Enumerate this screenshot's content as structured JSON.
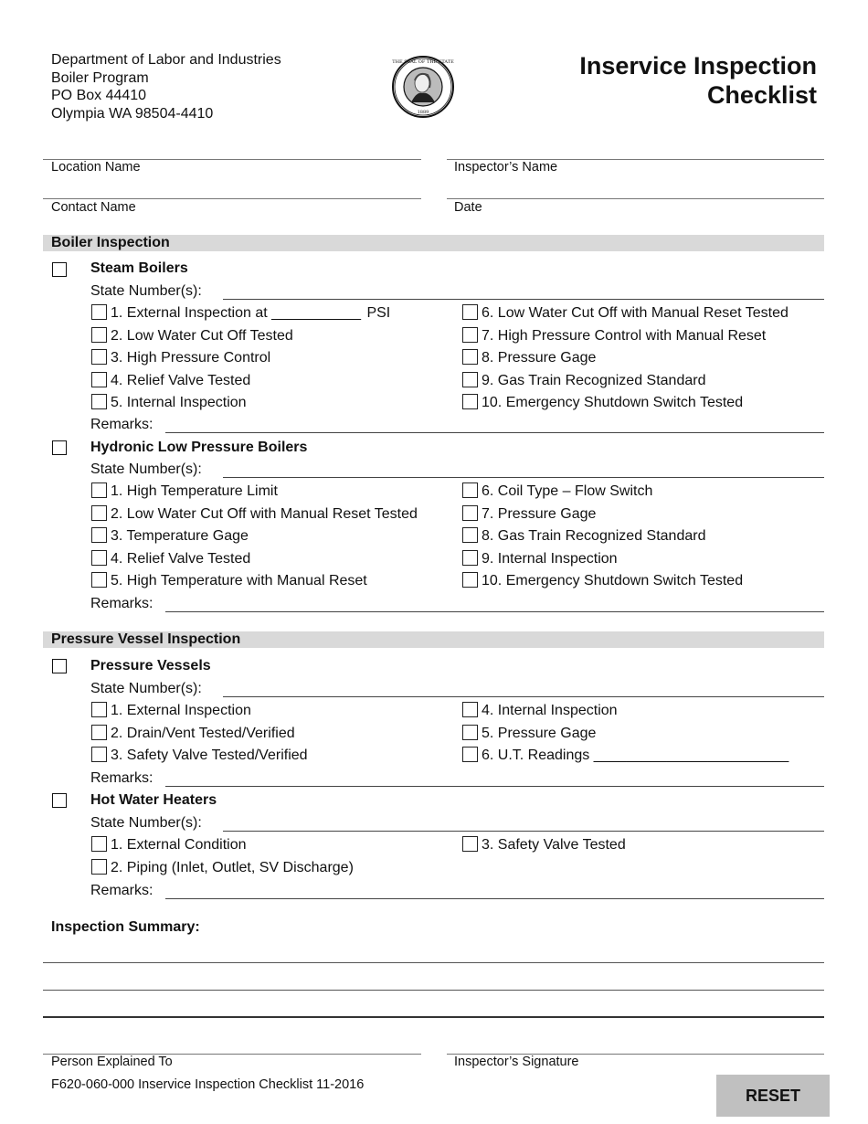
{
  "header": {
    "address_lines": [
      "Department of Labor and Industries",
      "Boiler Program",
      "PO Box 44410",
      "Olympia WA 98504-4410"
    ],
    "seal_icon": "washington-state-seal",
    "title_line1": "Inservice Inspection",
    "title_line2": "Checklist"
  },
  "info_fields": {
    "location_name": {
      "label": "Location Name",
      "value": ""
    },
    "inspectors_name": {
      "label": "Inspector’s Name",
      "value": ""
    },
    "contact_name": {
      "label": "Contact Name",
      "value": ""
    },
    "date": {
      "label": "Date",
      "value": ""
    }
  },
  "boiler_inspection": {
    "heading": "Boiler Inspection",
    "steam_boilers": {
      "title": "Steam Boilers",
      "state_numbers_label": "State Number(s):",
      "state_numbers_value": "",
      "left_items": [
        {
          "label_before": "1. External Inspection at",
          "blank": "___________",
          "label_after": "PSI",
          "checked": false
        },
        {
          "label": "2. Low Water Cut Off Tested",
          "checked": false
        },
        {
          "label": "3. High Pressure Control",
          "checked": false
        },
        {
          "label": "4. Relief Valve Tested",
          "checked": false
        },
        {
          "label": "5. Internal Inspection",
          "checked": false
        }
      ],
      "right_items": [
        {
          "label": "6. Low Water Cut Off with Manual Reset Tested",
          "checked": false
        },
        {
          "label": "7. High Pressure Control with Manual Reset",
          "checked": false
        },
        {
          "label": "8. Pressure Gage",
          "checked": false
        },
        {
          "label": "9. Gas Train Recognized Standard",
          "checked": false
        },
        {
          "label": "10. Emergency Shutdown Switch Tested",
          "checked": false
        }
      ],
      "remarks_label": "Remarks:",
      "remarks_value": ""
    },
    "hydronic_boilers": {
      "title": "Hydronic Low Pressure Boilers",
      "state_numbers_label": "State Number(s):",
      "state_numbers_value": "",
      "left_items": [
        {
          "label": "1. High Temperature Limit",
          "checked": false
        },
        {
          "label": "2. Low Water Cut Off with Manual Reset Tested",
          "checked": false
        },
        {
          "label": "3. Temperature Gage",
          "checked": false
        },
        {
          "label": "4. Relief Valve Tested",
          "checked": false
        },
        {
          "label": "5. High Temperature with Manual Reset",
          "checked": false
        }
      ],
      "right_items": [
        {
          "label": "6. Coil Type – Flow Switch",
          "checked": false
        },
        {
          "label": "7. Pressure Gage",
          "checked": false
        },
        {
          "label": "8. Gas Train Recognized Standard",
          "checked": false
        },
        {
          "label": "9. Internal Inspection",
          "checked": false
        },
        {
          "label": "10. Emergency Shutdown Switch Tested",
          "checked": false
        }
      ],
      "remarks_label": "Remarks:",
      "remarks_value": ""
    }
  },
  "pressure_vessel_inspection": {
    "heading": "Pressure Vessel Inspection",
    "pressure_vessels": {
      "title": "Pressure Vessels",
      "state_numbers_label": "State Number(s):",
      "state_numbers_value": "",
      "left_items": [
        {
          "label": "1. External Inspection",
          "checked": false
        },
        {
          "label": "2. Drain/Vent Tested/Verified",
          "checked": false
        },
        {
          "label": "3. Safety Valve Tested/Verified",
          "checked": false
        }
      ],
      "right_items": [
        {
          "label": "4. Internal Inspection",
          "checked": false
        },
        {
          "label": "5. Pressure Gage",
          "checked": false
        },
        {
          "label": "6. U.T. Readings",
          "blank": "________________________",
          "checked": false
        }
      ],
      "remarks_label": "Remarks:",
      "remarks_value": ""
    },
    "hot_water_heaters": {
      "title": "Hot Water Heaters",
      "state_numbers_label": "State Number(s):",
      "state_numbers_value": "",
      "left_items": [
        {
          "label": "1. External Condition",
          "checked": false
        },
        {
          "label": "2. Piping (Inlet, Outlet, SV Discharge)",
          "checked": false
        }
      ],
      "right_items": [
        {
          "label": "3. Safety Valve Tested",
          "checked": false
        }
      ],
      "remarks_label": "Remarks:",
      "remarks_value": ""
    }
  },
  "summary": {
    "label": "Inspection Summary:",
    "value": ""
  },
  "signatures": {
    "person_explained_to": {
      "label": "Person Explained To",
      "value": ""
    },
    "inspectors_signature": {
      "label": "Inspector’s Signature",
      "value": ""
    }
  },
  "footer": {
    "form_id": "F620-060-000 Inservice Inspection Checklist  11-2016"
  },
  "reset_button": {
    "label": "RESET",
    "color": "#c0c0c0"
  },
  "colors": {
    "section_bar": "#d9d9d9",
    "text": "#111111"
  }
}
